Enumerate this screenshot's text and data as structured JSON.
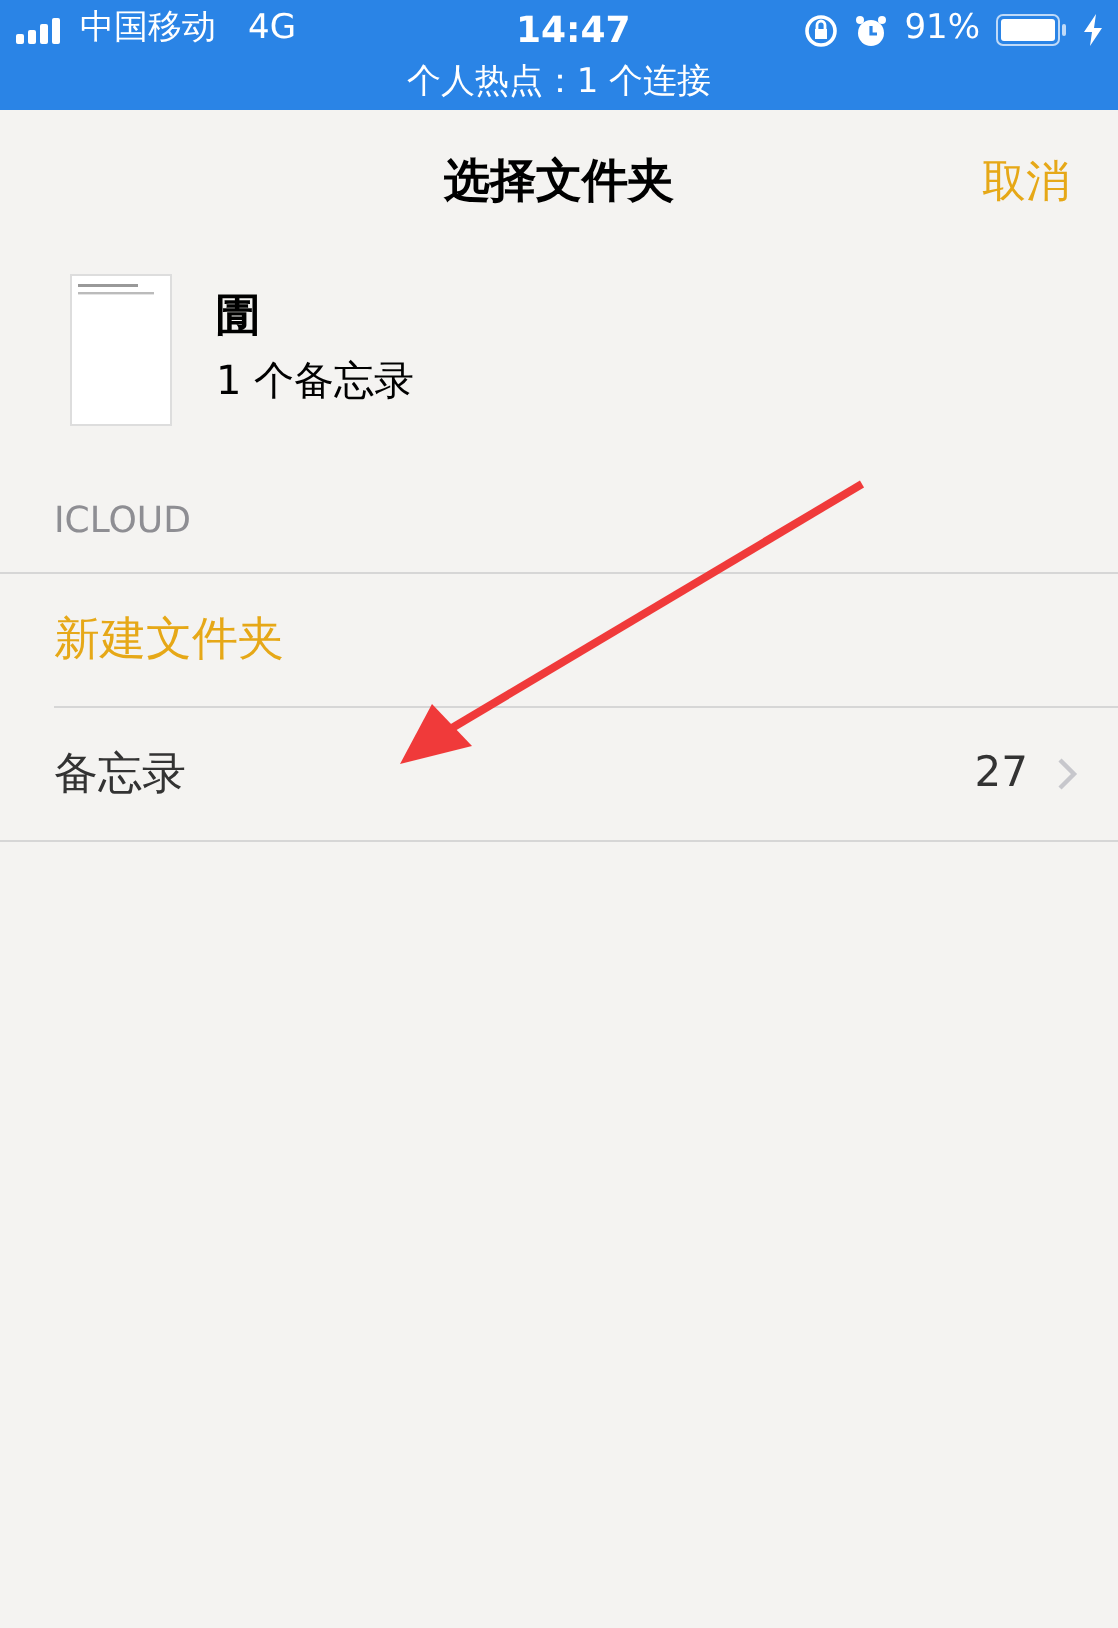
{
  "status_bar": {
    "carrier": "中国移动",
    "network": "4G",
    "time": "14:47",
    "battery_percent": "91%"
  },
  "hotspot_banner": "个人热点：1 个连接",
  "nav": {
    "title": "选择文件夹",
    "cancel": "取消"
  },
  "note": {
    "title": "圊",
    "count": "1 个备忘录"
  },
  "section_header": "ICLOUD",
  "new_folder": "新建文件夹",
  "folders": [
    {
      "name": "备忘录",
      "count": "27"
    }
  ]
}
